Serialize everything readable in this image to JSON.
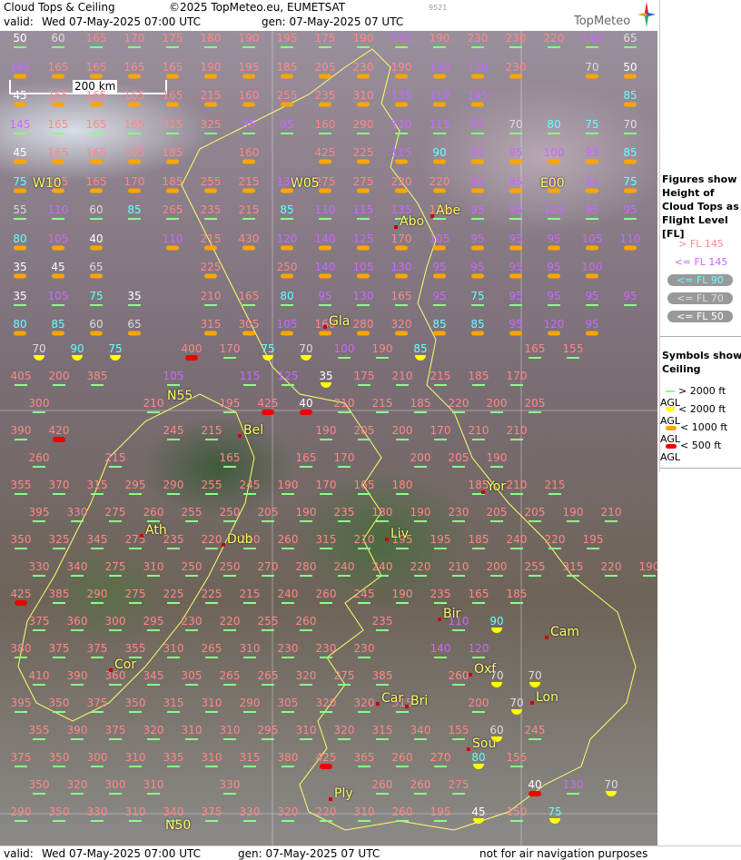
{
  "header": {
    "title": "Cloud Tops & Ceiling",
    "copyright": "©2025 TopMeteo.eu, EUMETSAT",
    "tiny": "9521",
    "valid_label": "valid:",
    "valid_value": "Wed   07-May-2025   07:00 UTC",
    "gen": "gen: 07-May-2025 07 UTC",
    "brand": "TopMeteo"
  },
  "footer": {
    "valid_label": "valid:",
    "valid_value": "Wed   07-May-2025   07:00 UTC",
    "gen": "gen: 07-May-2025 07 UTC",
    "disclaimer": "not for air navigation purposes"
  },
  "scale_label": "200 km",
  "legend": {
    "figures_title": "Figures show Height of Cloud Tops as Flight Level [FL]",
    "figures": [
      {
        "text": "> FL 145",
        "color": "#ff8888"
      },
      {
        "text": "<= FL 145",
        "color": "#cc66ff"
      },
      {
        "text": "<= FL 90",
        "color": "#66ffff"
      },
      {
        "text": "<= FL 70",
        "color": "#dddddd"
      },
      {
        "text": "<= FL 50",
        "color": "#ffffff"
      }
    ],
    "symbols_title": "Symbols show Ceiling",
    "symbols": [
      {
        "text": "> 2000 ft AGL",
        "kind": "line",
        "color": "#88ff88"
      },
      {
        "text": "< 2000 ft AGL",
        "kind": "half",
        "color": "#ffff00"
      },
      {
        "text": "< 1000 ft AGL",
        "kind": "bar",
        "color": "#ffa500"
      },
      {
        "text": "< 500 ft AGL",
        "kind": "bar",
        "color": "#ee0000"
      }
    ]
  },
  "map": {
    "grid_rows": [
      [
        "50",
        "60",
        "165",
        "170",
        "175",
        "180",
        "190",
        "195",
        "175",
        "190",
        "135",
        "190",
        "230",
        "230",
        "220",
        "110",
        "65"
      ],
      [
        "145",
        "165",
        "165",
        "165",
        "165",
        "190",
        "195",
        "185",
        "205",
        "230",
        "190",
        "130",
        "130",
        "230",
        "",
        "70",
        "50"
      ],
      [
        "45",
        "165",
        "165",
        "165",
        "165",
        "215",
        "160",
        "255",
        "235",
        "310",
        "135",
        "110",
        "145",
        "",
        "",
        "",
        "85"
      ],
      [
        "145",
        "165",
        "165",
        "165",
        "315",
        "325",
        "95",
        "95",
        "160",
        "290",
        "110",
        "115",
        "95",
        "70",
        "80",
        "75",
        "70"
      ],
      [
        "45",
        "165",
        "165",
        "165",
        "185",
        "",
        "160",
        "",
        "425",
        "225",
        "115",
        "90",
        "95",
        "95",
        "100",
        "95",
        "85"
      ],
      [
        "75",
        "155",
        "165",
        "170",
        "185",
        "255",
        "215",
        "130",
        "275",
        "275",
        "220",
        "220",
        "95",
        "95",
        "95",
        "95",
        "75"
      ],
      [
        "55",
        "110",
        "60",
        "85",
        "265",
        "235",
        "215",
        "85",
        "110",
        "115",
        "135",
        "150",
        "95",
        "95",
        "105",
        "95",
        "95"
      ],
      [
        "80",
        "105",
        "40",
        "",
        "110",
        "215",
        "430",
        "120",
        "140",
        "125",
        "170",
        "105",
        "95",
        "95",
        "95",
        "105",
        "110"
      ],
      [
        "35",
        "45",
        "65",
        "",
        "",
        "225",
        "",
        "250",
        "140",
        "105",
        "130",
        "95",
        "95",
        "95",
        "95",
        "100",
        ""
      ],
      [
        "35",
        "105",
        "75",
        "35",
        "",
        "210",
        "165",
        "80",
        "95",
        "130",
        "165",
        "95",
        "75",
        "95",
        "95",
        "95",
        "95"
      ],
      [
        "80",
        "85",
        "60",
        "65",
        "",
        "315",
        "305",
        "105",
        "160",
        "280",
        "320",
        "85",
        "85",
        "95",
        "120",
        "95",
        ""
      ]
    ],
    "cities": [
      "Abo",
      "Abe",
      "Gla",
      "Bel",
      "N55",
      "W10",
      "W05",
      "E00",
      "Dub",
      "Ath",
      "Liv",
      "Yor",
      "Bir",
      "Cam",
      "Cor",
      "Oxf",
      "Car",
      "Bri",
      "Lon",
      "Sou",
      "Ply",
      "N50"
    ],
    "lower_rows": [
      [
        "70",
        "90",
        "75",
        "",
        "400",
        "170",
        "75",
        "70",
        "100",
        "190",
        "85",
        "",
        "",
        "165",
        "155"
      ],
      [
        "405",
        "200",
        "385",
        "",
        "105",
        "",
        "115",
        "125",
        "35",
        "175",
        "210",
        "215",
        "185",
        "170",
        ""
      ],
      [
        "300",
        "",
        "",
        "210",
        "",
        "195",
        "425",
        "40",
        "210",
        "215",
        "185",
        "220",
        "200",
        "205",
        ""
      ],
      [
        "390",
        "420",
        "",
        "",
        "245",
        "215",
        "",
        "",
        "190",
        "205",
        "200",
        "170",
        "210",
        "210",
        ""
      ],
      [
        "260",
        "",
        "215",
        "",
        "",
        "165",
        "",
        "165",
        "170",
        "",
        "200",
        "205",
        "190",
        ""
      ],
      [
        "355",
        "370",
        "315",
        "295",
        "290",
        "255",
        "245",
        "190",
        "170",
        "165",
        "180",
        "",
        "185",
        "210",
        "215"
      ],
      [
        "395",
        "330",
        "275",
        "260",
        "255",
        "250",
        "205",
        "190",
        "235",
        "180",
        "190",
        "230",
        "205",
        "205",
        "190",
        "210"
      ],
      [
        "350",
        "325",
        "345",
        "275",
        "235",
        "220",
        "210",
        "260",
        "315",
        "210",
        "195",
        "195",
        "185",
        "240",
        "220",
        "195"
      ],
      [
        "330",
        "340",
        "275",
        "310",
        "250",
        "250",
        "270",
        "280",
        "240",
        "240",
        "220",
        "210",
        "200",
        "255",
        "315",
        "220",
        "190"
      ],
      [
        "425",
        "385",
        "290",
        "275",
        "225",
        "225",
        "215",
        "240",
        "260",
        "245",
        "190",
        "235",
        "165",
        "185"
      ],
      [
        "375",
        "360",
        "300",
        "295",
        "230",
        "220",
        "255",
        "260",
        "",
        "235",
        "",
        "110",
        "90"
      ],
      [
        "380",
        "375",
        "375",
        "355",
        "310",
        "265",
        "310",
        "230",
        "230",
        "230",
        "",
        "140",
        "120"
      ],
      [
        "410",
        "390",
        "360",
        "345",
        "305",
        "265",
        "265",
        "320",
        "275",
        "385",
        "",
        "260",
        "70",
        "70"
      ],
      [
        "395",
        "350",
        "375",
        "350",
        "315",
        "310",
        "290",
        "305",
        "320",
        "320",
        "315",
        "",
        "200",
        "70"
      ],
      [
        "355",
        "390",
        "375",
        "320",
        "310",
        "310",
        "295",
        "310",
        "320",
        "315",
        "340",
        "155",
        "60",
        "245"
      ],
      [
        "375",
        "350",
        "300",
        "310",
        "335",
        "310",
        "315",
        "380",
        "425",
        "365",
        "260",
        "270",
        "80",
        "155"
      ],
      [
        "350",
        "320",
        "300",
        "310",
        "",
        "330",
        "",
        "",
        "",
        "260",
        "260",
        "275",
        "",
        "40",
        "130",
        "70"
      ],
      [
        "290",
        "350",
        "330",
        "310",
        "340",
        "375",
        "330",
        "320",
        "220",
        "310",
        "260",
        "195",
        "45",
        "150",
        "75"
      ]
    ]
  }
}
